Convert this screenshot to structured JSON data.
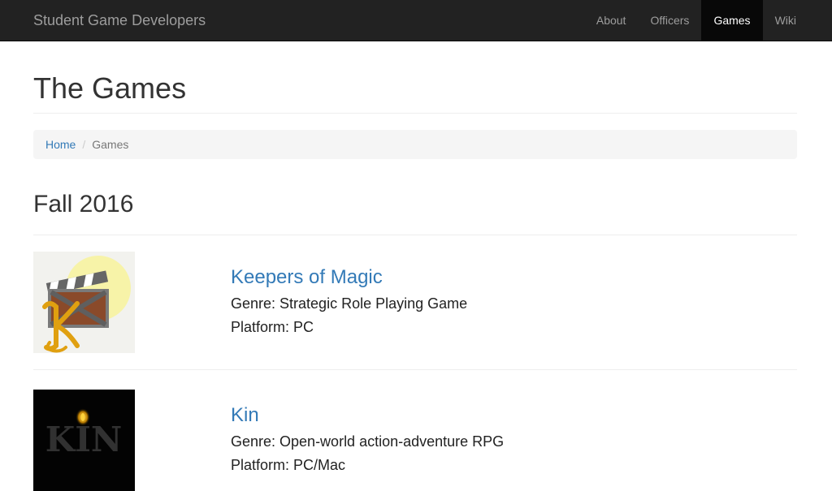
{
  "navbar": {
    "brand": "Student Game Developers",
    "items": [
      {
        "label": "About",
        "active": false
      },
      {
        "label": "Officers",
        "active": false
      },
      {
        "label": "Games",
        "active": true
      },
      {
        "label": "Wiki",
        "active": false
      }
    ]
  },
  "page": {
    "title": "The Games",
    "breadcrumb": {
      "home": "Home",
      "separator": "/",
      "current": "Games"
    }
  },
  "section": {
    "title": "Fall 2016",
    "games": [
      {
        "name": "Keepers of Magic",
        "genre_label": "Genre:",
        "genre": "Strategic Role Playing Game",
        "platform_label": "Platform:",
        "platform": "PC",
        "thumb_icon": "keepers-of-magic-logo"
      },
      {
        "name": "Kin",
        "genre_label": "Genre:",
        "genre": "Open-world action-adventure RPG",
        "platform_label": "Platform:",
        "platform": "PC/Mac",
        "thumb_icon": "kin-logo"
      }
    ]
  },
  "colors": {
    "navbar_bg": "#222222",
    "nav_active_bg": "#080808",
    "link": "#337ab7",
    "breadcrumb_bg": "#f5f5f5"
  }
}
